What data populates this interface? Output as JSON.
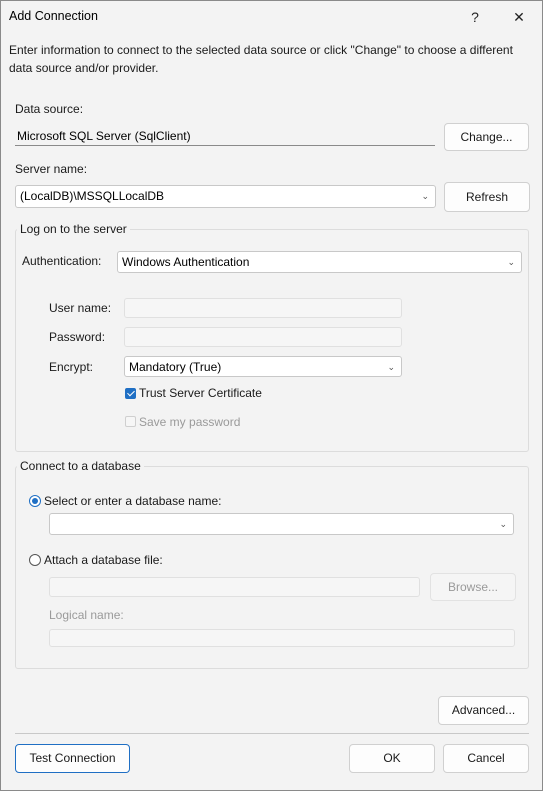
{
  "window": {
    "title": "Add Connection",
    "help_glyph": "?",
    "close_glyph": "✕"
  },
  "intro_text": "Enter information to connect to the selected data source or click \"Change\" to choose a different data source and/or provider.",
  "data_source": {
    "label": "Data source:",
    "value": "Microsoft SQL Server (SqlClient)",
    "change_button": "Change..."
  },
  "server": {
    "label": "Server name:",
    "value": "(LocalDB)\\MSSQLLocalDB",
    "refresh_button": "Refresh"
  },
  "logon": {
    "legend": "Log on to the server",
    "auth_label": "Authentication:",
    "auth_value": "Windows Authentication",
    "username_label": "User name:",
    "username_value": "",
    "password_label": "Password:",
    "password_value": "",
    "encrypt_label": "Encrypt:",
    "encrypt_value": "Mandatory (True)",
    "trust_cert_label": "Trust Server Certificate",
    "trust_cert_checked": true,
    "save_password_label": "Save my password",
    "save_password_checked": false
  },
  "database": {
    "legend": "Connect to a database",
    "select_option_label": "Select or enter a database name:",
    "select_value": "",
    "attach_option_label": "Attach a database file:",
    "attach_value": "",
    "browse_button": "Browse...",
    "logical_name_label": "Logical name:",
    "logical_name_value": ""
  },
  "footer": {
    "advanced_button": "Advanced...",
    "test_button": "Test Connection",
    "ok_button": "OK",
    "cancel_button": "Cancel"
  },
  "colors": {
    "accent": "#1f6fc4",
    "background": "#f3f3f3"
  }
}
